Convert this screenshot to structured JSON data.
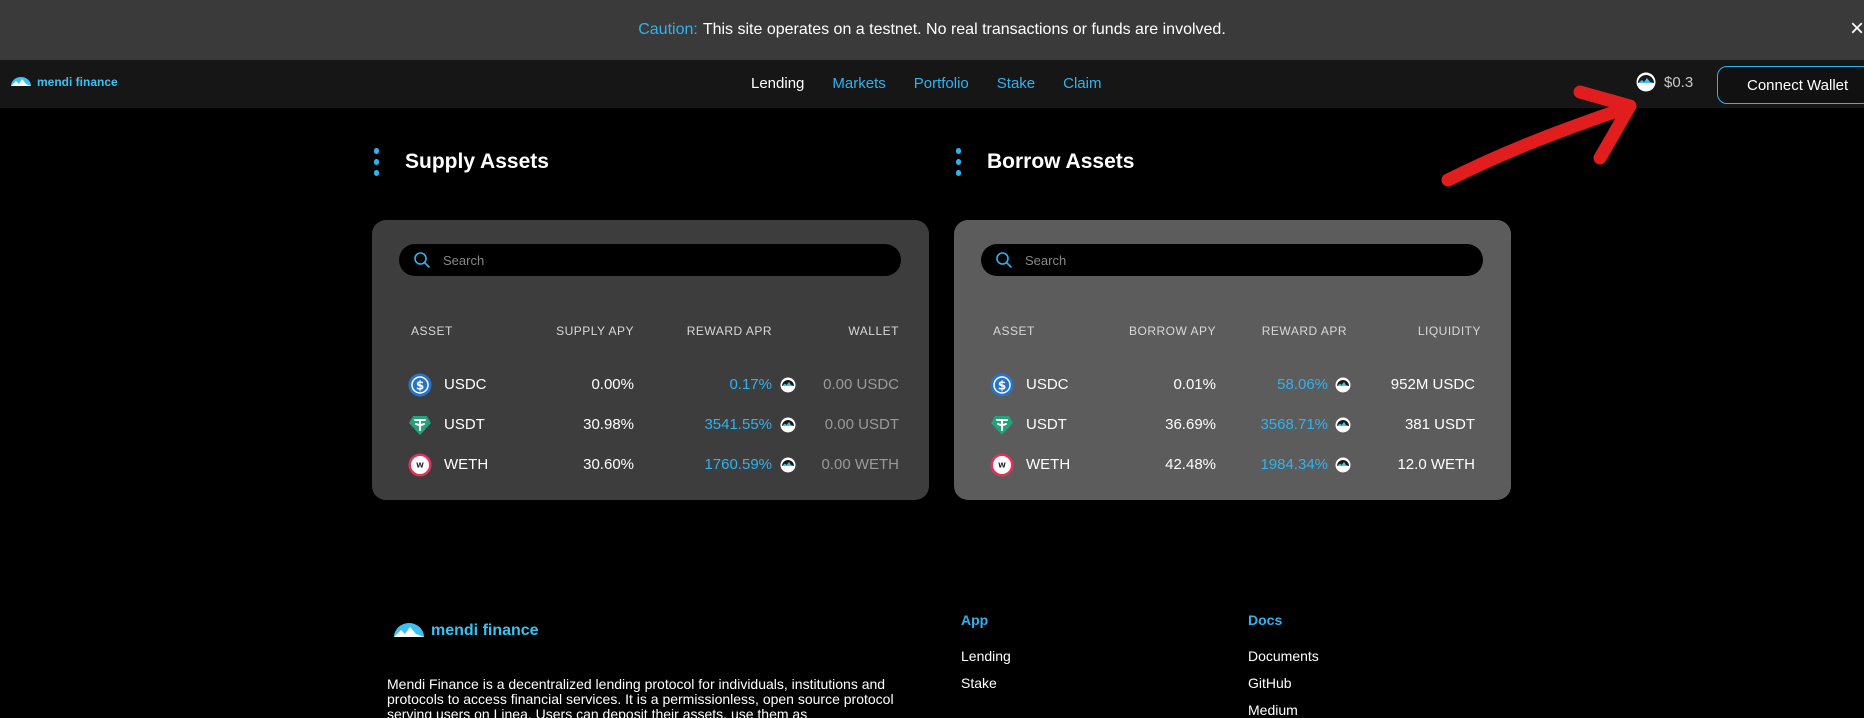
{
  "banner": {
    "label": "Caution:",
    "text": "This site operates on a testnet. No real transactions or funds are involved.",
    "close_glyph": "×"
  },
  "header": {
    "brand": "mendi finance",
    "nav": [
      {
        "label": "Lending",
        "active": true
      },
      {
        "label": "Markets"
      },
      {
        "label": "Portfolio"
      },
      {
        "label": "Stake"
      },
      {
        "label": "Claim"
      }
    ],
    "token_price": "$0.3",
    "connect_label": "Connect Wallet"
  },
  "supply": {
    "title": "Supply Assets",
    "search_placeholder": "Search",
    "columns": [
      "ASSET",
      "SUPPLY APY",
      "REWARD APR",
      "WALLET"
    ],
    "rows": [
      {
        "asset": "USDC",
        "apy": "0.00%",
        "reward": "0.17%",
        "wallet": "0.00 USDC"
      },
      {
        "asset": "USDT",
        "apy": "30.98%",
        "reward": "3541.55%",
        "wallet": "0.00 USDT"
      },
      {
        "asset": "WETH",
        "apy": "30.60%",
        "reward": "1760.59%",
        "wallet": "0.00 WETH"
      }
    ]
  },
  "borrow": {
    "title": "Borrow Assets",
    "search_placeholder": "Search",
    "columns": [
      "ASSET",
      "BORROW APY",
      "REWARD APR",
      "LIQUIDITY"
    ],
    "rows": [
      {
        "asset": "USDC",
        "apy": "0.01%",
        "reward": "58.06%",
        "liquidity": "952M USDC"
      },
      {
        "asset": "USDT",
        "apy": "36.69%",
        "reward": "3568.71%",
        "liquidity": "381 USDT"
      },
      {
        "asset": "WETH",
        "apy": "42.48%",
        "reward": "1984.34%",
        "liquidity": "12.0 WETH"
      }
    ]
  },
  "footer": {
    "brand": "mendi finance",
    "description": "Mendi Finance is a decentralized lending protocol for individuals, institutions and protocols to access financial services. It is a permissionless, open source protocol serving users on Linea. Users can deposit their assets, use them as",
    "app": {
      "title": "App",
      "links": [
        "Lending",
        "Stake"
      ]
    },
    "docs": {
      "title": "Docs",
      "links": [
        "Documents",
        "GitHub",
        "Medium"
      ]
    }
  },
  "colors": {
    "accent": "#2eb3f0",
    "annotation_arrow": "#e11d1d",
    "usdc": "#2775ca",
    "usdt": "#26a17b"
  }
}
